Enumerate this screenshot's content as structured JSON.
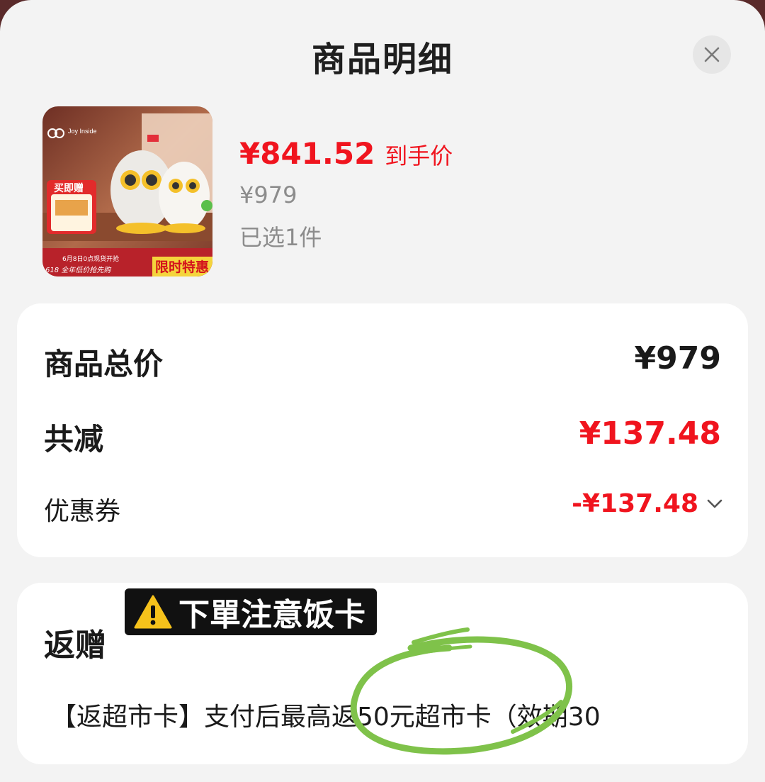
{
  "header": {
    "title": "商品明细",
    "close_icon": "close-icon"
  },
  "product": {
    "image_badges": {
      "gift": "买即赠",
      "date": "6月8日0点现货开抢",
      "promo": "618 全年低价抢先购",
      "limited": "限时特惠",
      "brand": "Joy Inside"
    },
    "final_price": "¥841.52",
    "final_price_label": "到手价",
    "original_price": "¥979",
    "selected_count": "已选1件"
  },
  "summary": {
    "total_label": "商品总价",
    "total_value": "¥979",
    "discount_label": "共减",
    "discount_value": "¥137.48",
    "coupon_label": "优惠券",
    "coupon_value": "-¥137.48",
    "coupon_icon": "chevron-down-icon"
  },
  "gift": {
    "title": "返赠",
    "sticker_text": "下單注意饭卡",
    "sticker_icon": "warning-icon",
    "description": "【返超市卡】支付后最高返50元超市卡（效期30"
  },
  "colors": {
    "accent_red": "#f0141e",
    "annotation_green": "#7fc24a"
  }
}
